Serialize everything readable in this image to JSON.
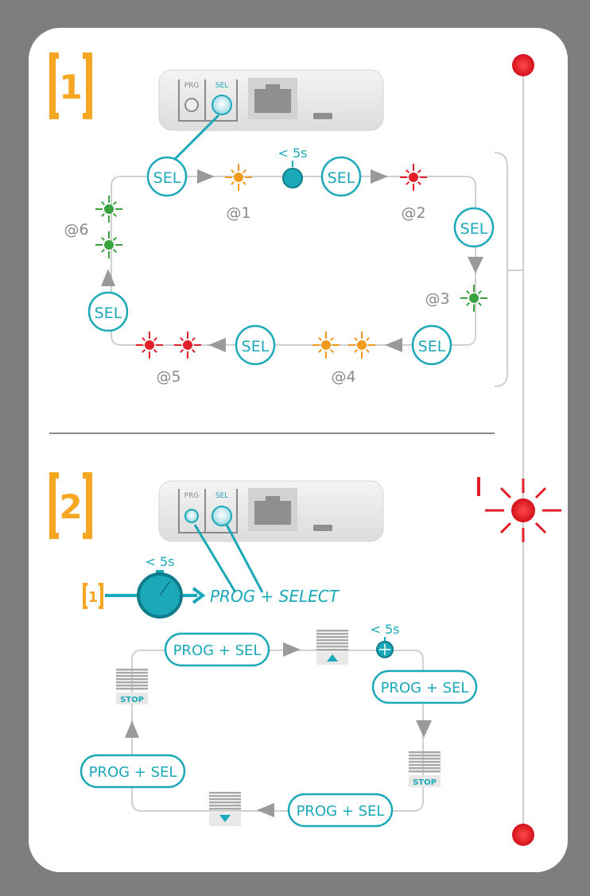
{
  "section1": {
    "step_number": "1",
    "device": {
      "prg_label": "PRG",
      "sel_label": "SEL"
    },
    "sel_label": "SEL",
    "timer_label": "< 5s",
    "modes": [
      "@1",
      "@2",
      "@3",
      "@4",
      "@5",
      "@6"
    ]
  },
  "section2": {
    "step_number": "2",
    "device": {
      "prg_label": "PRG",
      "sel_label": "SEL"
    },
    "timer_label": "< 5s",
    "ref_step": "1",
    "action_label": "PROG + SELECT",
    "prog_sel_label": "PROG + SEL",
    "loop_timer_label": "< 5s",
    "stop_label": "STOP"
  },
  "colors": {
    "background": "#7e7e80",
    "card": "#ffffff",
    "accent": "#1ba8b8",
    "step_badge": "#f5a623",
    "arrow_gray": "#9a9a9a",
    "led_orange": "#f39a1e",
    "led_red": "#e3202a",
    "led_green": "#3aa33f"
  }
}
